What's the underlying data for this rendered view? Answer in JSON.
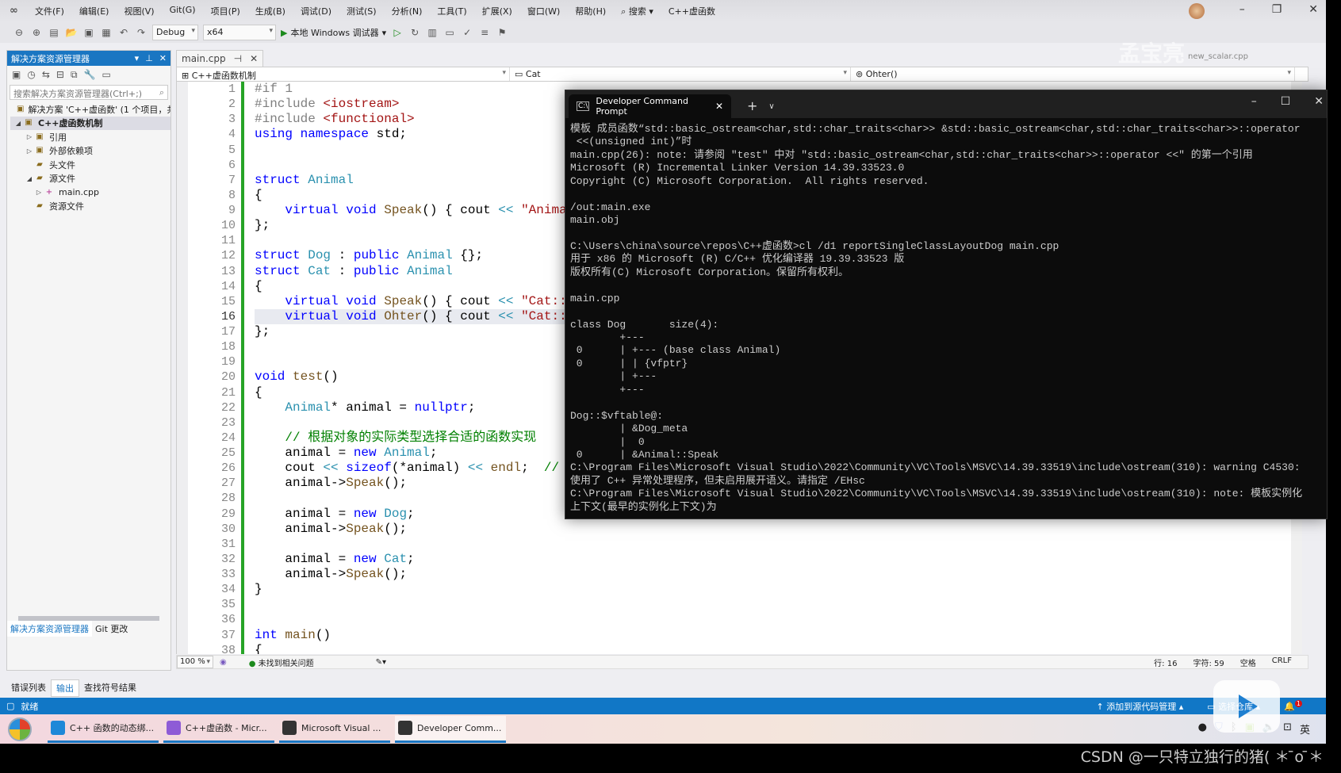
{
  "menu": {
    "items": [
      "文件(F)",
      "编辑(E)",
      "视图(V)",
      "Git(G)",
      "项目(P)",
      "生成(B)",
      "调试(D)",
      "测试(S)",
      "分析(N)",
      "工具(T)",
      "扩展(X)",
      "窗口(W)",
      "帮助(H)"
    ],
    "search_label": "搜索",
    "solution_name": "C++虚函数"
  },
  "toolbar": {
    "config": "Debug",
    "platform": "x64",
    "run_label": "本地 Windows 调试器"
  },
  "solution_explorer": {
    "title": "解决方案资源管理器",
    "search_placeholder": "搜索解决方案资源管理器(Ctrl+;)",
    "items": [
      {
        "label": "解决方案 'C++虚函数' (1 个项目，共",
        "icon": "solution-icon",
        "twisty": ""
      },
      {
        "label": "C++虚函数机制",
        "icon": "project-icon",
        "twisty": "◢",
        "selected": true
      },
      {
        "label": "引用",
        "icon": "reference-icon",
        "twisty": "▷"
      },
      {
        "label": "外部依赖项",
        "icon": "dependency-icon",
        "twisty": "▷"
      },
      {
        "label": "头文件",
        "icon": "folder-icon",
        "twisty": ""
      },
      {
        "label": "源文件",
        "icon": "folder-icon",
        "twisty": "◢"
      },
      {
        "label": "main.cpp",
        "icon": "cpp-file-icon",
        "twisty": "▷",
        "indent": true
      },
      {
        "label": "资源文件",
        "icon": "folder-icon",
        "twisty": ""
      }
    ],
    "tabs": [
      "解决方案资源管理器",
      "Git 更改"
    ]
  },
  "editor": {
    "tab": "main.cpp",
    "nav": {
      "scope": "C++虚函数机制",
      "class": "Cat",
      "member": "Ohter()"
    },
    "current_line": 16,
    "lines": [
      [
        [
          "#if 1",
          "pp"
        ]
      ],
      [
        [
          "#include ",
          "pp"
        ],
        [
          "<iostream>",
          "st"
        ]
      ],
      [
        [
          "#include ",
          "pp"
        ],
        [
          "<functional>",
          "st"
        ]
      ],
      [
        [
          "using namespace ",
          "kw"
        ],
        [
          "std;",
          "pl"
        ]
      ],
      [],
      [],
      [
        [
          "struct ",
          "kw"
        ],
        [
          "Animal",
          "ty"
        ]
      ],
      [
        [
          "{",
          "pl"
        ]
      ],
      [
        [
          "    virtual void ",
          "kw"
        ],
        [
          "Speak",
          "fn"
        ],
        [
          "() { cout ",
          "pl"
        ],
        [
          "<< ",
          "ty"
        ],
        [
          "\"Anima",
          "st"
        ]
      ],
      [
        [
          "};",
          "pl"
        ]
      ],
      [],
      [
        [
          "struct ",
          "kw"
        ],
        [
          "Dog",
          "ty"
        ],
        [
          " : ",
          "pl"
        ],
        [
          "public ",
          "kw"
        ],
        [
          "Animal",
          "ty"
        ],
        [
          " {};",
          "pl"
        ]
      ],
      [
        [
          "struct ",
          "kw"
        ],
        [
          "Cat",
          "ty"
        ],
        [
          " : ",
          "pl"
        ],
        [
          "public ",
          "kw"
        ],
        [
          "Animal",
          "ty"
        ]
      ],
      [
        [
          "{",
          "pl"
        ]
      ],
      [
        [
          "    virtual void ",
          "kw"
        ],
        [
          "Speak",
          "fn"
        ],
        [
          "() { cout ",
          "pl"
        ],
        [
          "<< ",
          "ty"
        ],
        [
          "\"Cat::",
          "st"
        ]
      ],
      [
        [
          "    virtual void ",
          "kw"
        ],
        [
          "Ohter",
          "fn"
        ],
        [
          "() { cout ",
          "pl"
        ],
        [
          "<< ",
          "ty"
        ],
        [
          "\"Cat::",
          "st"
        ]
      ],
      [
        [
          "};",
          "pl"
        ]
      ],
      [],
      [],
      [
        [
          "void ",
          "kw"
        ],
        [
          "test",
          "fn"
        ],
        [
          "()",
          "pl"
        ]
      ],
      [
        [
          "{",
          "pl"
        ]
      ],
      [
        [
          "    ",
          "pl"
        ],
        [
          "Animal",
          "ty"
        ],
        [
          "* animal = ",
          "pl"
        ],
        [
          "nullptr",
          "kw"
        ],
        [
          ";",
          "pl"
        ]
      ],
      [],
      [
        [
          "    // 根据对象的实际类型选择合适的函数实现",
          "cm"
        ]
      ],
      [
        [
          "    animal = ",
          "pl"
        ],
        [
          "new ",
          "kw"
        ],
        [
          "Animal",
          "ty"
        ],
        [
          ";",
          "pl"
        ]
      ],
      [
        [
          "    cout ",
          "pl"
        ],
        [
          "<< ",
          "ty"
        ],
        [
          "sizeof",
          "kw"
        ],
        [
          "(*animal) ",
          "pl"
        ],
        [
          "<< ",
          "ty"
        ],
        [
          "endl",
          "fn"
        ],
        [
          ";  ",
          "pl"
        ],
        [
          "//",
          "cm"
        ]
      ],
      [
        [
          "    animal->",
          "pl"
        ],
        [
          "Speak",
          "fn"
        ],
        [
          "();",
          "pl"
        ]
      ],
      [],
      [
        [
          "    animal = ",
          "pl"
        ],
        [
          "new ",
          "kw"
        ],
        [
          "Dog",
          "ty"
        ],
        [
          ";",
          "pl"
        ]
      ],
      [
        [
          "    animal->",
          "pl"
        ],
        [
          "Speak",
          "fn"
        ],
        [
          "();",
          "pl"
        ]
      ],
      [],
      [
        [
          "    animal = ",
          "pl"
        ],
        [
          "new ",
          "kw"
        ],
        [
          "Cat",
          "ty"
        ],
        [
          ";",
          "pl"
        ]
      ],
      [
        [
          "    animal->",
          "pl"
        ],
        [
          "Speak",
          "fn"
        ],
        [
          "();",
          "pl"
        ]
      ],
      [
        [
          "}",
          "pl"
        ]
      ],
      [],
      [],
      [
        [
          "int ",
          "kw"
        ],
        [
          "main",
          "fn"
        ],
        [
          "()",
          "pl"
        ]
      ],
      [
        [
          "{",
          "pl"
        ]
      ]
    ],
    "status": {
      "zoom": "100 %",
      "issues": "未找到相关问题",
      "line": "行: 16",
      "char": "字符: 59",
      "spacing": "空格",
      "eol": "CRLF"
    }
  },
  "bottom_tabs": [
    "错误列表",
    "输出",
    "查找符号结果"
  ],
  "statusbar": {
    "ready": "就绪",
    "source_control": "添加到源代码管理",
    "repo": "选择仓库",
    "notifications": "1"
  },
  "terminal": {
    "tab_title": "Developer Command Prompt",
    "lines": [
      "模板 成员函数“std::basic_ostream<char,std::char_traits<char>> &std::basic_ostream<char,std::char_traits<char>>::operator",
      " <<(unsigned int)”时",
      "main.cpp(26): note: 请参阅 \"test\" 中对 \"std::basic_ostream<char,std::char_traits<char>>::operator <<\" 的第一个引用",
      "Microsoft (R) Incremental Linker Version 14.39.33523.0",
      "Copyright (C) Microsoft Corporation.  All rights reserved.",
      "",
      "/out:main.exe",
      "main.obj",
      "",
      "C:\\Users\\china\\source\\repos\\C++虚函数>cl /d1 reportSingleClassLayoutDog main.cpp",
      "用于 x86 的 Microsoft (R) C/C++ 优化编译器 19.39.33523 版",
      "版权所有(C) Microsoft Corporation。保留所有权利。",
      "",
      "main.cpp",
      "",
      "class Dog       size(4):",
      "        +---",
      " 0      | +--- (base class Animal)",
      " 0      | | {vfptr}",
      "        | +---",
      "        +---",
      "",
      "Dog::$vftable@:",
      "        | &Dog_meta",
      "        |  0",
      " 0      | &Animal::Speak",
      "C:\\Program Files\\Microsoft Visual Studio\\2022\\Community\\VC\\Tools\\MSVC\\14.39.33519\\include\\ostream(310): warning C4530:",
      "使用了 C++ 异常处理程序，但未启用展开语义。请指定 /EHsc",
      "C:\\Program Files\\Microsoft Visual Studio\\2022\\Community\\VC\\Tools\\MSVC\\14.39.33519\\include\\ostream(310): note: 模板实例化",
      "上下文(最早的实例化上下文)为"
    ]
  },
  "taskbar": {
    "items": [
      {
        "label": "C++ 函数的动态绑...",
        "icon": "edge-icon",
        "color": "#1e88d8"
      },
      {
        "label": "C++虚函数 - Micr...",
        "icon": "visual-studio-icon",
        "color": "#8e5bd6"
      },
      {
        "label": "Microsoft Visual ...",
        "icon": "terminal-icon",
        "color": "#333333"
      },
      {
        "label": "Developer Comm...",
        "icon": "terminal-icon",
        "color": "#333333",
        "active": true
      }
    ],
    "tray_lang": "英"
  },
  "overlay": {
    "watermark": "CSDN @一只特立独行的猪( ＊ ̄o ̄＊",
    "faint_name": "孟宝亮",
    "faint_tab": "new_scalar.cpp"
  },
  "colors": {
    "accent": "#1177c6",
    "terminal_bg": "#0c0c0c",
    "change_bar": "#26a426"
  }
}
